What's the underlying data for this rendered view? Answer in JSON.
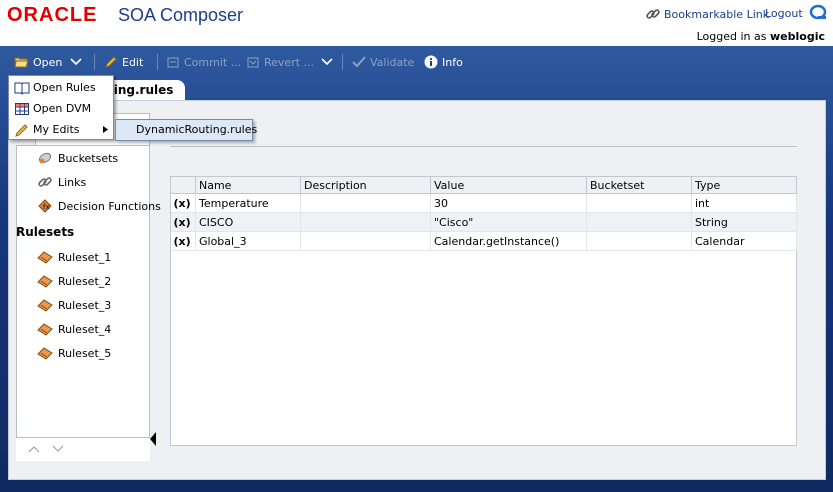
{
  "header": {
    "brand": "ORACLE",
    "product": "SOA Composer",
    "bookmarkable_link": "Bookmarkable Link",
    "logout": "Logout",
    "logged_in_prefix": "Logged in as",
    "username": "weblogic"
  },
  "toolbar": {
    "open": "Open",
    "edit": "Edit",
    "commit": "Commit ...",
    "revert": "Revert ...",
    "validate": "Validate",
    "info": "Info"
  },
  "document_tab": "ting.rules",
  "open_menu": {
    "items": [
      "Open Rules",
      "Open DVM",
      "My Edits"
    ],
    "submenu_item": "DynamicRouting.rules"
  },
  "nav": {
    "bucketsets": "Bucketsets",
    "links": "Links",
    "decision_functions": "Decision Functions",
    "rulesets_title": "Rulesets",
    "rulesets": [
      "Ruleset_1",
      "Ruleset_2",
      "Ruleset_3",
      "Ruleset_4",
      "Ruleset_5"
    ]
  },
  "table": {
    "columns": [
      "Name",
      "Description",
      "Value",
      "Bucketset",
      "Type"
    ],
    "rows": [
      {
        "icon": "(x)",
        "name": "Temperature",
        "description": "",
        "value": "30",
        "bucketset": "",
        "type": "int"
      },
      {
        "icon": "(x)",
        "name": "CISCO",
        "description": "",
        "value": "\"Cisco\"",
        "bucketset": "",
        "type": "String"
      },
      {
        "icon": "(x)",
        "name": "Global_3",
        "description": "",
        "value": "Calendar.getInstance()",
        "bucketset": "",
        "type": "Calendar"
      }
    ]
  },
  "colors": {
    "brand_red": "#e00000",
    "link_blue": "#1c3d8c",
    "toolbar_bg": "#16357a"
  }
}
